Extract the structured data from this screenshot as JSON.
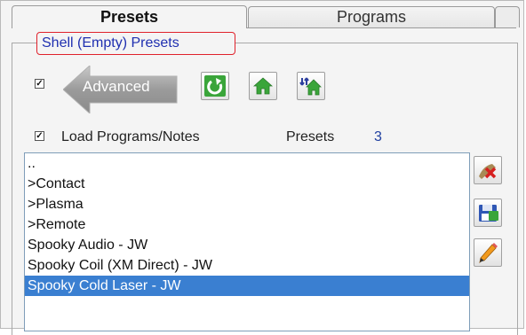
{
  "tabs": [
    {
      "label": "Presets",
      "active": true
    },
    {
      "label": "Programs",
      "active": false
    }
  ],
  "group_title": "Shell (Empty) Presets",
  "advanced": {
    "label": "Advanced",
    "checked": true
  },
  "toolbar_icons": [
    "refresh-icon",
    "home-icon",
    "home-sync-icon"
  ],
  "load_programs": {
    "label": "Load Programs/Notes",
    "checked": true
  },
  "presets_counter": {
    "label": "Presets",
    "value": "3"
  },
  "list": {
    "items": [
      "..",
      ">Contact",
      ">Plasma",
      ">Remote",
      "Spooky Audio - JW",
      "Spooky Coil (XM Direct) - JW",
      "Spooky Cold Laser - JW"
    ],
    "selected_index": 6
  },
  "side_icons": [
    "delete-preset-icon",
    "save-preset-icon",
    "edit-preset-icon"
  ],
  "colors": {
    "accent_red": "#e0212b",
    "group_title_blue": "#1f2fb0",
    "selection_blue": "#3a7fd1",
    "icon_green": "#3aa53a"
  }
}
